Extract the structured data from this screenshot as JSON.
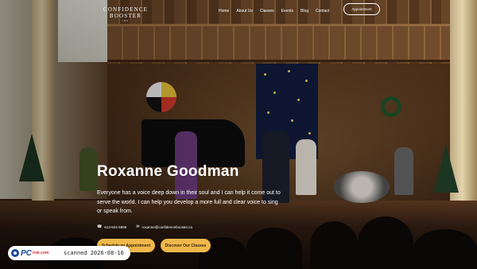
{
  "header": {
    "logo": {
      "line1": "CONFIDENCE",
      "line2": "BOOSTER",
      "line3": "INC"
    },
    "nav": [
      {
        "label": "Home"
      },
      {
        "label": "About Us"
      },
      {
        "label": "Classes"
      },
      {
        "label": "Events"
      },
      {
        "label": "Blog"
      },
      {
        "label": "Contact"
      }
    ],
    "appointment_label": "Appointment"
  },
  "hero": {
    "title": "Roxanne Goodman",
    "text": "Everyone has a voice deep down in their soul and I can help it come out to serve the world. I can help you develop a more full and clear voice to sing or speak from.",
    "phone": "613-824-5898",
    "email": "roxanne@confidencebooster.ca",
    "phone_icon": "phone-icon",
    "email_icon": "mail-icon",
    "cta_primary": "Schedule an Appointment",
    "cta_secondary": "Discover Our Classes"
  },
  "watermark": {
    "logo_text": "PC",
    "logo_suffix": "risk.com",
    "text": "scanned 2026-08-16"
  },
  "colors": {
    "accent": "#f0b84a",
    "nav_text": "#ffffff",
    "watermark_brand": "#1a4aa0"
  }
}
